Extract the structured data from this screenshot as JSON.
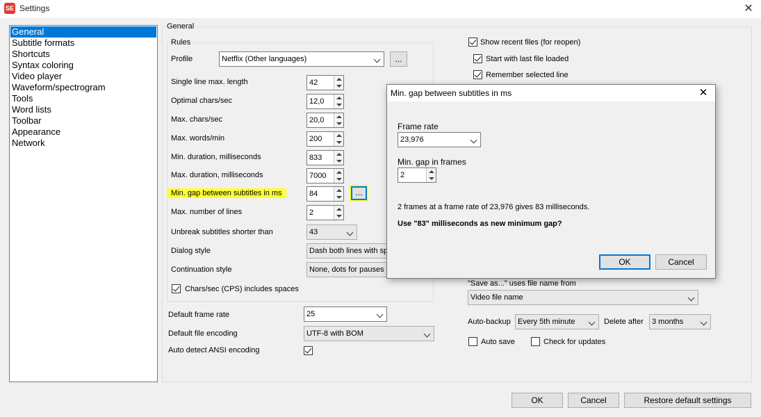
{
  "window": {
    "title": "Settings",
    "icon_text": "SE",
    "close_glyph": "✕"
  },
  "nav": {
    "items": [
      "General",
      "Subtitle formats",
      "Shortcuts",
      "Syntax coloring",
      "Video player",
      "Waveform/spectrogram",
      "Tools",
      "Word lists",
      "Toolbar",
      "Appearance",
      "Network"
    ],
    "selected": "General"
  },
  "general": {
    "group_label": "General",
    "rules": {
      "label": "Rules",
      "profile_label": "Profile",
      "profile_value": "Netflix (Other languages)",
      "profile_button": "...",
      "single_line_label": "Single line max. length",
      "single_line_value": "42",
      "optimal_cps_label": "Optimal chars/sec",
      "optimal_cps_value": "12,0",
      "max_cps_label": "Max. chars/sec",
      "max_cps_value": "20,0",
      "max_wpm_label": "Max. words/min",
      "max_wpm_value": "200",
      "min_dur_label": "Min. duration, milliseconds",
      "min_dur_value": "833",
      "max_dur_label": "Max. duration, milliseconds",
      "max_dur_value": "7000",
      "min_gap_label": "Min. gap between subtitles in ms",
      "min_gap_value": "84",
      "min_gap_button": "...",
      "max_lines_label": "Max. number of lines",
      "max_lines_value": "2",
      "unbreak_label": "Unbreak subtitles shorter than",
      "unbreak_value": "43",
      "dialog_style_label": "Dialog style",
      "dialog_style_value": "Dash both lines with space",
      "continuation_label": "Continuation style",
      "continuation_value": "None, dots for pauses (trailing only)",
      "cps_spaces_label": "Chars/sec (CPS) includes spaces",
      "cps_spaces_checked": true
    },
    "default_frame_rate_label": "Default frame rate",
    "default_frame_rate_value": "25",
    "default_encoding_label": "Default file encoding",
    "default_encoding_value": "UTF-8 with BOM",
    "auto_ansi_label": "Auto detect ANSI encoding",
    "auto_ansi_checked": true,
    "show_recent_label": "Show recent files (for reopen)",
    "show_recent_checked": true,
    "start_last_label": "Start with last file loaded",
    "start_last_checked": true,
    "remember_line_label": "Remember selected line",
    "remember_line_checked": true,
    "save_as_label": "\"Save as...\" uses file name from",
    "save_as_value": "Video file name",
    "auto_backup_label": "Auto-backup",
    "auto_backup_value": "Every 5th minute",
    "delete_after_label": "Delete after",
    "delete_after_value": "3 months",
    "auto_save_label": "Auto save",
    "auto_save_checked": false,
    "check_updates_label": "Check for updates",
    "check_updates_checked": false
  },
  "footer": {
    "ok": "OK",
    "cancel": "Cancel",
    "restore": "Restore default settings"
  },
  "dialog": {
    "title": "Min. gap between subtitles in ms",
    "close_glyph": "✕",
    "frame_rate_label": "Frame rate",
    "frame_rate_value": "23,976",
    "min_gap_frames_label": "Min. gap in frames",
    "min_gap_frames_value": "2",
    "info_text": "2 frames at a frame rate of 23,976 gives 83 milliseconds.",
    "question": "Use \"83\" milliseconds as new minimum gap?",
    "ok": "OK",
    "cancel": "Cancel"
  },
  "colors": {
    "accent": "#0078d7",
    "highlight": "#ffff33"
  }
}
